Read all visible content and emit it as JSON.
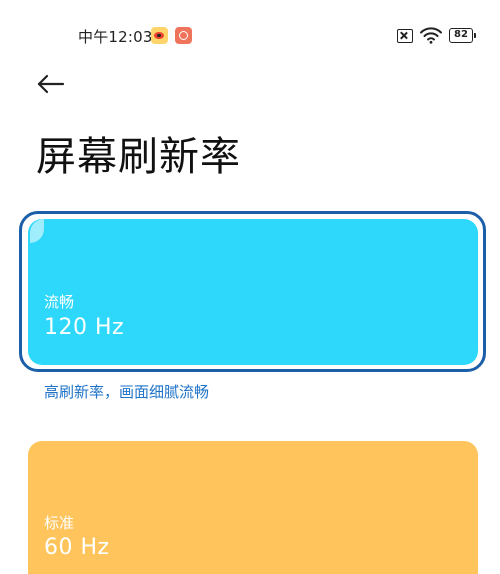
{
  "status_bar": {
    "time": "中午12:03",
    "battery_level": "82",
    "notification_icons": [
      "weibo-icon",
      "app-icon"
    ],
    "system_icons": [
      "sim-disabled-icon",
      "wifi-icon",
      "battery-icon"
    ]
  },
  "header": {
    "back_icon": "arrow-left-icon",
    "title": "屏幕刷新率"
  },
  "options": [
    {
      "label": "流畅",
      "value": "120 Hz",
      "description": "高刷新率，画面细腻流畅",
      "selected": true,
      "color": "#2dd8fb",
      "outline_color": "#1b5fa8"
    },
    {
      "label": "标准",
      "value": "60 Hz",
      "selected": false,
      "color": "#ffc55c"
    }
  ],
  "colors": {
    "description_text": "#1e73c8",
    "background": "#ffffff"
  }
}
